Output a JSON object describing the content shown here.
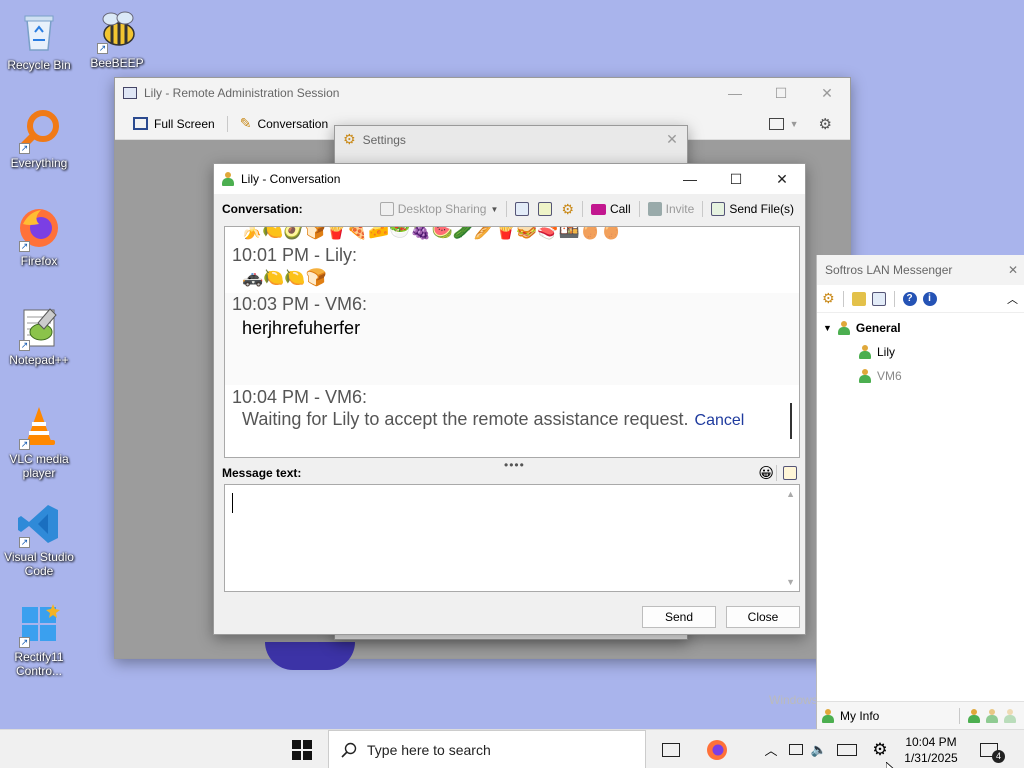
{
  "desktop": {
    "icons": [
      {
        "label": "Recycle Bin"
      },
      {
        "label": "BeeBEEP"
      },
      {
        "label": "Everything"
      },
      {
        "label": "Firefox"
      },
      {
        "label": "Notepad++"
      },
      {
        "label": "VLC media player"
      },
      {
        "label": "Visual Studio Code"
      },
      {
        "label": "Rectify11 Contro..."
      }
    ],
    "watermark": "Windows"
  },
  "remote_window": {
    "title": "Lily - Remote Administration Session",
    "toolbar": {
      "fullscreen": "Full Screen",
      "conversation": "Conversation"
    }
  },
  "settings_window": {
    "title": "Settings"
  },
  "conversation_window": {
    "title": "Lily - Conversation",
    "conversation_label": "Conversation:",
    "tools": {
      "desktop_sharing": "Desktop Sharing",
      "call": "Call",
      "invite": "Invite",
      "send_files": "Send File(s)"
    },
    "messages": [
      {
        "header": "10:01 PM - Lily:",
        "body": "🚓🍋🍋🍞"
      },
      {
        "header": "10:03 PM - VM6:",
        "body": "herjhrefuherfer"
      },
      {
        "header": "10:04 PM - VM6:",
        "body": "Waiting for Lily to accept the remote assistance request.",
        "link": "Cancel"
      }
    ],
    "emoji_row": "🍌🍋🥑🍞🍟🍕🧀🥗🍇🍉🥒🥖🍟🥪🍣🍱🥚🥚",
    "message_text_label": "Message text:",
    "message_value": "",
    "send_button": "Send",
    "close_button": "Close"
  },
  "lan_messenger": {
    "title": "Softros LAN Messenger",
    "group": "General",
    "users": [
      "Lily",
      "VM6"
    ],
    "my_info": "My Info"
  },
  "taskbar": {
    "search_placeholder": "Type here to search",
    "time": "10:04 PM",
    "date": "1/31/2025",
    "notification_count": "4"
  },
  "colors": {
    "desktop": "#a9b4ec",
    "link": "#1f3b9e",
    "vscode": "#2f8ad8",
    "firefox": "#ff7139"
  }
}
